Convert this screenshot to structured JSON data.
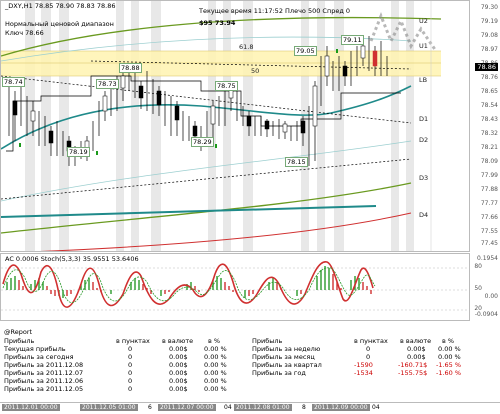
{
  "main_chart": {
    "header": "_DXY,H1  78.85 78.90 78.83 78.86",
    "note_line1": "Нормальный ценовой диапазон",
    "note_line2": "Ключ 78.66",
    "countdown": "$95 73.94",
    "server_time": "Текущее время 11:17:52  Плечо 500  Спред 0",
    "current_price": "78.86",
    "axis_ticks": [
      "79.30",
      "79.19",
      "79.08",
      "78.97",
      "78.86",
      "78.76",
      "78.65",
      "78.54",
      "78.43",
      "78.32",
      "78.21",
      "78.09",
      "77.99",
      "77.88",
      "77.77",
      "77.66",
      "77.55",
      "77.45"
    ],
    "level_labels": [
      "U2",
      "U1",
      "LB",
      "D1",
      "D2",
      "D3",
      "D4"
    ],
    "fib_labels": [
      "61.8",
      "50"
    ],
    "price_tags": [
      "78.74",
      "78.73",
      "78.88",
      "78.75",
      "78.19",
      "78.29",
      "78.15",
      "79.05",
      "79.11"
    ]
  },
  "indicator": {
    "label": "AC 0.0006  Stoch(5,3,3) 35.9551 53.6406",
    "right_ticks": [
      "80",
      "50",
      "20"
    ],
    "right_values": [
      "0.1954",
      "0.00",
      "-0.0904"
    ]
  },
  "report": {
    "title": "@Report",
    "left_headers": [
      "Прибыль",
      "в пунктах",
      "в валюте",
      "в %"
    ],
    "left_rows": [
      [
        "Текущая прибыль",
        "0",
        "0.00$",
        "0.00 %"
      ],
      [
        "Прибыль за сегодня",
        "0",
        "0.00$",
        "0.00 %"
      ],
      [
        "Прибыль за 2011.12.08",
        "0",
        "0.00$",
        "0.00 %"
      ],
      [
        "Прибыль за 2011.12.07",
        "0",
        "0.00$",
        "0.00 %"
      ],
      [
        "Прибыль за 2011.12.06",
        "0",
        "0.00$",
        "0.00 %"
      ],
      [
        "Прибыль за 2011.12.05",
        "0",
        "0.00$",
        "0.00 %"
      ]
    ],
    "right_headers": [
      "Прибыль",
      "в пунктах",
      "в валюте",
      "в %"
    ],
    "right_rows": [
      [
        "Прибыль за неделю",
        "0",
        "0.00$",
        "0.00 %"
      ],
      [
        "Прибыль за месяц",
        "0",
        "0.00$",
        "0.00 %"
      ],
      [
        "Прибыль за квартал",
        "-1590",
        "-160.71$",
        "-1.65 %"
      ],
      [
        "Прибыль за год",
        "-1534",
        "-155.75$",
        "-1.60 %"
      ]
    ]
  },
  "time_labels": [
    "2011.12.01 00:00",
    "2011.12.05 01:00",
    "6",
    "2011.12.07 00:00",
    "04",
    "2011.12.08 01:00",
    "8",
    "2011.12.09 00:00",
    "04"
  ],
  "colors": {
    "fib_band": "#fff3b0",
    "ma_line": "#1f8a8a",
    "green_line": "#6a9a20",
    "red_line": "#d03030"
  }
}
